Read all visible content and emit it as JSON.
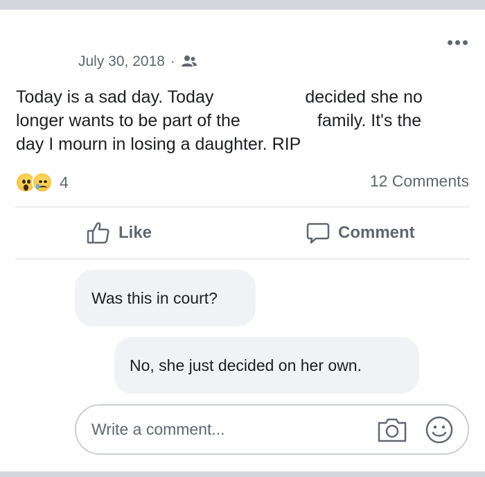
{
  "post": {
    "date": "July 30, 2018",
    "separator": "·",
    "audience_icon": "friends-icon",
    "text_lines": [
      "Today is a sad day. Today                   decided she no",
      "longer wants to be part of the                family. It's the",
      "day I mourn in losing a daughter. RIP"
    ],
    "more_icon": "more-options-icon"
  },
  "reactions": {
    "icons": [
      "wow-icon",
      "sad-icon"
    ],
    "count": "4"
  },
  "comments_count": "12 Comments",
  "actions": {
    "like_label": "Like",
    "comment_label": "Comment"
  },
  "comments": [
    {
      "text": "Was this in court?"
    },
    {
      "text": "No, she just decided on her own."
    }
  ],
  "composer": {
    "placeholder": "Write a comment...",
    "value": "",
    "icons": [
      "camera-icon",
      "emoji-icon"
    ]
  },
  "colors": {
    "text": "#1c1e21",
    "secondary": "#606770",
    "bubble": "#f0f2f5",
    "divider": "#dadde1",
    "frame": "#d3d6db"
  }
}
